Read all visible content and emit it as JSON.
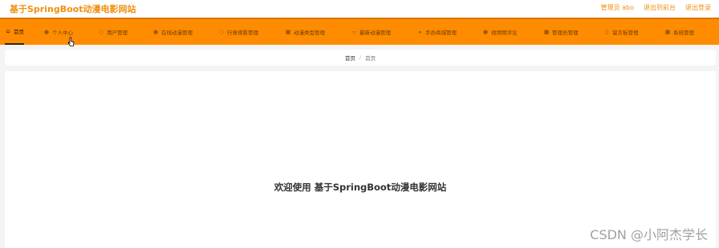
{
  "header": {
    "site_title": "基于SpringBoot动漫电影网站",
    "links": [
      "管理员 abo",
      "退出到前台",
      "退出登录"
    ]
  },
  "nav": {
    "items": [
      {
        "label": "首页",
        "icon": "home-icon",
        "active": true
      },
      {
        "label": "个人中心",
        "icon": "user-icon"
      },
      {
        "label": "用户管理",
        "icon": "users-icon"
      },
      {
        "label": "在线动漫管理",
        "icon": "film-icon"
      },
      {
        "label": "行意观看管理",
        "icon": "watch-icon"
      },
      {
        "label": "动漫类型管理",
        "icon": "category-icon"
      },
      {
        "label": "最新动漫管理",
        "icon": "news-icon"
      },
      {
        "label": "手办商城管理",
        "icon": "shop-icon"
      },
      {
        "label": "视频频评论",
        "icon": "comment-icon"
      },
      {
        "label": "管理员管理",
        "icon": "admin-icon"
      },
      {
        "label": "留言板管理",
        "icon": "message-icon"
      },
      {
        "label": "系统管理",
        "icon": "settings-icon"
      }
    ]
  },
  "breadcrumb": {
    "home": "首页",
    "separator": "/",
    "current": "首页"
  },
  "main": {
    "welcome": "欢迎使用 基于SpringBoot动漫电影网站"
  },
  "watermark": "CSDN @小阿杰学长",
  "colors": {
    "accent": "#ff8c00",
    "title": "#f18f10"
  }
}
